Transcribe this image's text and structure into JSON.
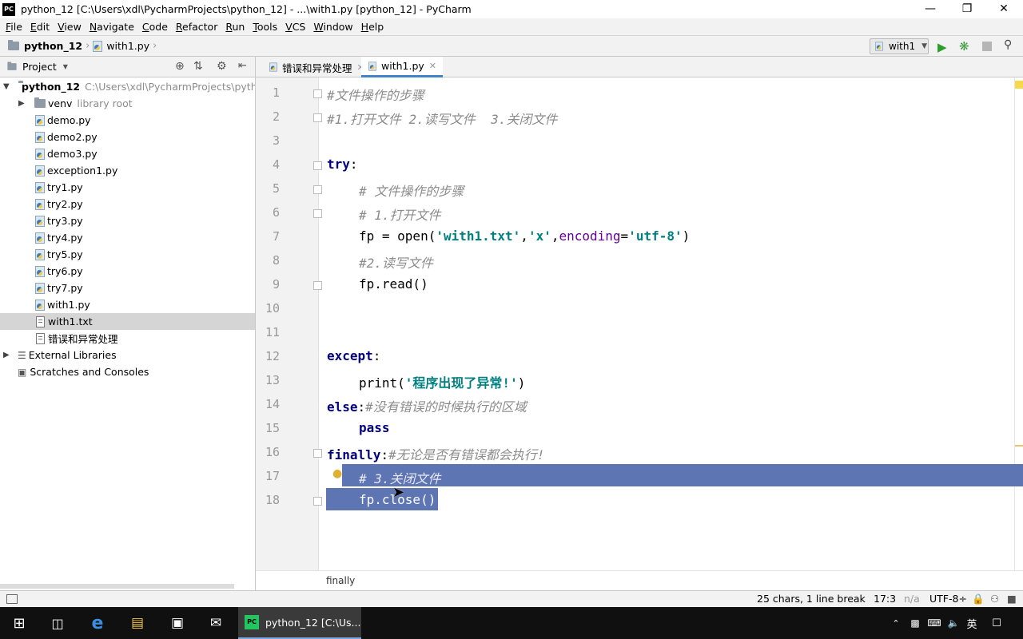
{
  "window": {
    "title": "python_12 [C:\\Users\\xdl\\PycharmProjects\\python_12] - ...\\with1.py [python_12] - PyCharm",
    "logo_text": "PC"
  },
  "menu": [
    "File",
    "Edit",
    "View",
    "Navigate",
    "Code",
    "Refactor",
    "Run",
    "Tools",
    "VCS",
    "Window",
    "Help"
  ],
  "navbar": {
    "project": "python_12",
    "file": "with1.py",
    "run_config": "with1"
  },
  "project_panel": {
    "title": "Project",
    "root": {
      "name": "python_12",
      "path": "C:\\Users\\xdl\\PycharmProjects\\pytho"
    },
    "venv": {
      "name": "venv",
      "note": "library root"
    },
    "files": [
      "demo.py",
      "demo2.py",
      "demo3.py",
      "exception1.py",
      "try1.py",
      "try2.py",
      "try3.py",
      "try4.py",
      "try5.py",
      "try6.py",
      "try7.py",
      "with1.py",
      "with1.txt",
      "错误和异常处理"
    ],
    "external": "External Libraries",
    "scratches": "Scratches and Consoles"
  },
  "tabs": [
    {
      "label": "错误和异常处理",
      "active": false
    },
    {
      "label": "with1.py",
      "active": true
    }
  ],
  "code": {
    "l1": "#文件操作的步骤",
    "l2": "#1.打开文件 2.读写文件  3.关闭文件",
    "l4_kw": "try",
    "l5": "# 文件操作的步骤",
    "l6": "# 1.打开文件",
    "l7_a": "fp = open(",
    "l7_s1": "'with1.txt'",
    "l7_c1": ",",
    "l7_s2": "'x'",
    "l7_c2": ",",
    "l7_kw": "encoding",
    "l7_eq": "=",
    "l7_s3": "'utf-8'",
    "l7_end": ")",
    "l8": "#2.读写文件",
    "l9": "fp.read()",
    "l12_kw": "except",
    "l13_a": "print(",
    "l13_s": "'程序出现了异常!'",
    "l13_end": ")",
    "l14_kw": "else",
    "l14_cm": "#没有错误的时候执行的区域",
    "l15_kw": "pass",
    "l16_kw": "finally",
    "l16_cm": "#无论是否有错误都会执行!",
    "l17": "# 3.关闭文件",
    "l18": "fp.close()",
    "colon": ":"
  },
  "line_numbers": [
    "1",
    "2",
    "3",
    "4",
    "5",
    "6",
    "7",
    "8",
    "9",
    "10",
    "11",
    "12",
    "13",
    "14",
    "15",
    "16",
    "17",
    "18"
  ],
  "editor_breadcrumb": "finally",
  "status": {
    "selection": "25 chars, 1 line break",
    "position": "17:3",
    "na": "n/a",
    "encoding": "UTF-8÷"
  },
  "taskbar": {
    "app_label": "python_12 [C:\\Us...",
    "ime": "英"
  },
  "colors": {
    "selection": "#5d75b3",
    "keyword": "#000080",
    "string": "#008080",
    "comment": "#8c8c8c",
    "kwarg": "#660099"
  }
}
